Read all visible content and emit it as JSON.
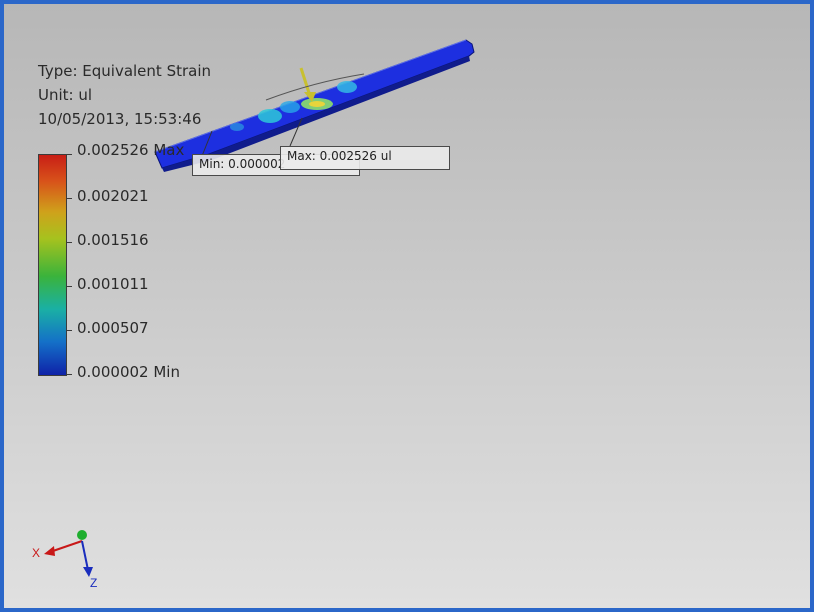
{
  "result": {
    "type_line": "Type: Equivalent Strain",
    "unit_line": "Unit: ul",
    "timestamp": "10/05/2013, 15:53:46"
  },
  "legend": {
    "levels": [
      {
        "value": "0.002526 Max"
      },
      {
        "value": "0.002021"
      },
      {
        "value": "0.001516"
      },
      {
        "value": "0.001011"
      },
      {
        "value": "0.000507"
      },
      {
        "value": "0.000002 Min"
      }
    ],
    "colors": [
      "#c81e16",
      "#cfa21b",
      "#a6c21e",
      "#3bb33b",
      "#1ab0a4",
      "#0f22a8"
    ]
  },
  "probes": {
    "min_label": "Min: 0.000002",
    "max_label": "Max: 0.002526 ul"
  },
  "triad": {
    "x_label": "X",
    "z_label": "Z"
  },
  "colors": {
    "border": "#2b67c9",
    "part": "#1d2fe0"
  }
}
